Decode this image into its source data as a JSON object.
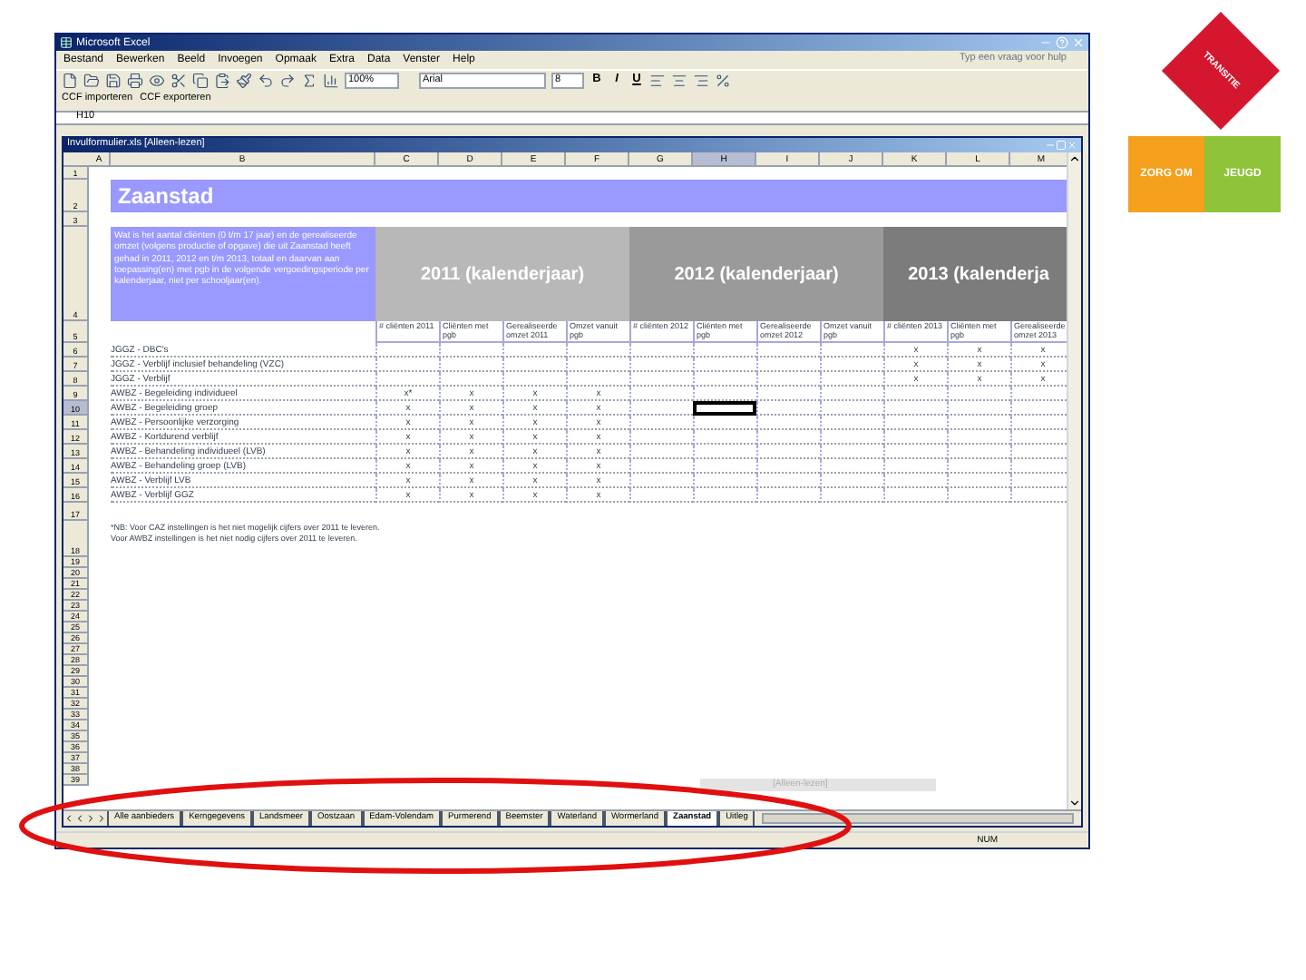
{
  "excel": {
    "title": "Microsoft Excel",
    "menu": [
      "Bestand",
      "Bewerken",
      "Beeld",
      "Invoegen",
      "Opmaak",
      "Extra",
      "Data",
      "Venster",
      "Help"
    ],
    "help_placeholder": "Typ een vraag voor hulp",
    "zoom": "100%",
    "font": "Arial",
    "font_size": "8",
    "format_buttons": [
      "B",
      "I",
      "U"
    ],
    "custom_toolbar": [
      "CCF importeren",
      "CCF exporteren"
    ],
    "name_box": "H10"
  },
  "workbook": {
    "title": "Invulformulier.xls  [Alleen-lezen]",
    "columns": [
      {
        "label": "A",
        "selected": false
      },
      {
        "label": "B",
        "selected": false
      },
      {
        "label": "C",
        "selected": false
      },
      {
        "label": "D",
        "selected": false
      },
      {
        "label": "E",
        "selected": false
      },
      {
        "label": "F",
        "selected": false
      },
      {
        "label": "G",
        "selected": false
      },
      {
        "label": "H",
        "selected": true
      },
      {
        "label": "I",
        "selected": false
      },
      {
        "label": "J",
        "selected": false
      },
      {
        "label": "K",
        "selected": false
      },
      {
        "label": "L",
        "selected": false
      },
      {
        "label": "M",
        "selected": false
      }
    ],
    "row_numbers": [
      {
        "label": "1",
        "selected": false
      },
      {
        "label": "2",
        "selected": false
      },
      {
        "label": "3",
        "selected": false
      },
      {
        "label": "4",
        "selected": false
      },
      {
        "label": "5",
        "selected": false
      },
      {
        "label": "6",
        "selected": false
      },
      {
        "label": "7",
        "selected": false
      },
      {
        "label": "8",
        "selected": false
      },
      {
        "label": "9",
        "selected": false
      },
      {
        "label": "10",
        "selected": true
      },
      {
        "label": "11",
        "selected": false
      },
      {
        "label": "12",
        "selected": false
      },
      {
        "label": "13",
        "selected": false
      },
      {
        "label": "14",
        "selected": false
      },
      {
        "label": "15",
        "selected": false
      },
      {
        "label": "16",
        "selected": false
      },
      {
        "label": "17",
        "selected": false
      },
      {
        "label": "18",
        "selected": false
      },
      {
        "label": "19",
        "selected": false
      },
      {
        "label": "20",
        "selected": false
      },
      {
        "label": "21",
        "selected": false
      },
      {
        "label": "22",
        "selected": false
      },
      {
        "label": "23",
        "selected": false
      },
      {
        "label": "24",
        "selected": false
      },
      {
        "label": "25",
        "selected": false
      },
      {
        "label": "26",
        "selected": false
      },
      {
        "label": "27",
        "selected": false
      },
      {
        "label": "28",
        "selected": false
      },
      {
        "label": "29",
        "selected": false
      },
      {
        "label": "30",
        "selected": false
      },
      {
        "label": "31",
        "selected": false
      },
      {
        "label": "32",
        "selected": false
      },
      {
        "label": "33",
        "selected": false
      },
      {
        "label": "34",
        "selected": false
      },
      {
        "label": "35",
        "selected": false
      },
      {
        "label": "36",
        "selected": false
      },
      {
        "label": "37",
        "selected": false
      },
      {
        "label": "38",
        "selected": false
      },
      {
        "label": "39",
        "selected": false
      }
    ],
    "sheet": {
      "title": "Zaanstad",
      "question": "Wat is het aantal cliënten (0 t/m 17 jaar) en de gerealiseerde omzet (volgens productie of opgave) die uit Zaanstad heeft gehad in 2011, 2012 en t/m 2013, totaal en daarvan aan toepassing(en) met pgb in de volgende vergoedingsperiode per kalenderjaar, niet per schooljaar(en).",
      "year_headers": [
        "2011 (kalenderjaar)",
        "2012 (kalenderjaar)",
        "2013 (kalenderja"
      ],
      "subheaders": [
        "# cliënten 2011",
        "Cliënten met pgb",
        "Gerealiseerde omzet 2011",
        "Omzet vanuit pgb",
        "# cliënten 2012",
        "Cliënten met pgb",
        "Gerealiseerde omzet 2012",
        "Omzet vanuit pgb",
        "# cliënten 2013",
        "Cliënten met pgb",
        "Gerealiseerde omzet 2013"
      ],
      "data_rows": [
        {
          "label": "JGGZ - DBC's",
          "cells": [
            "",
            "",
            "",
            "",
            "",
            "",
            "",
            "",
            "x",
            "x",
            "x"
          ]
        },
        {
          "label": "JGGZ - Verblijf inclusief behandeling (VZC)",
          "cells": [
            "",
            "",
            "",
            "",
            "",
            "",
            "",
            "",
            "x",
            "x",
            "x"
          ]
        },
        {
          "label": "JGGZ - Verblijf",
          "cells": [
            "",
            "",
            "",
            "",
            "",
            "",
            "",
            "",
            "x",
            "x",
            "x"
          ]
        },
        {
          "label": "AWBZ - Begeleiding individueel",
          "cells": [
            "x*",
            "x",
            "x",
            "x",
            "",
            "",
            "",
            "",
            "",
            "",
            ""
          ]
        },
        {
          "label": "AWBZ - Begeleiding groep",
          "cells": [
            "x",
            "x",
            "x",
            "x",
            "",
            "",
            "",
            "",
            "",
            "",
            ""
          ]
        },
        {
          "label": "AWBZ - Persoonlijke verzorging",
          "cells": [
            "x",
            "x",
            "x",
            "x",
            "",
            "",
            "",
            "",
            "",
            "",
            ""
          ]
        },
        {
          "label": "AWBZ - Kortdurend verblijf",
          "cells": [
            "x",
            "x",
            "x",
            "x",
            "",
            "",
            "",
            "",
            "",
            "",
            ""
          ]
        },
        {
          "label": "AWBZ - Behandeling individueel (LVB)",
          "cells": [
            "x",
            "x",
            "x",
            "x",
            "",
            "",
            "",
            "",
            "",
            "",
            ""
          ]
        },
        {
          "label": "AWBZ - Behandeling groep (LVB)",
          "cells": [
            "x",
            "x",
            "x",
            "x",
            "",
            "",
            "",
            "",
            "",
            "",
            ""
          ]
        },
        {
          "label": "AWBZ - Verblijf LVB",
          "cells": [
            "x",
            "x",
            "x",
            "x",
            "",
            "",
            "",
            "",
            "",
            "",
            ""
          ]
        },
        {
          "label": "AWBZ - Verblijf GGZ",
          "cells": [
            "x",
            "x",
            "x",
            "x",
            "",
            "",
            "",
            "",
            "",
            "",
            ""
          ]
        }
      ],
      "note": "*NB: Voor CAZ instellingen is het niet mogelijk cijfers over 2011 te leveren. Voor AWBZ instellingen is het niet nodig cijfers over 2011 te leveren."
    },
    "floating_label": "[Alleen-lezen]",
    "tabs": [
      {
        "label": "Alle aanbieders",
        "selected": false
      },
      {
        "label": "Kerngegevens",
        "selected": false
      },
      {
        "label": "Landsmeer",
        "selected": false
      },
      {
        "label": "Oostzaan",
        "selected": false
      },
      {
        "label": "Edam-Volendam",
        "selected": false
      },
      {
        "label": "Purmerend",
        "selected": false
      },
      {
        "label": "Beemster",
        "selected": false
      },
      {
        "label": "Waterland",
        "selected": false
      },
      {
        "label": "Wormerland",
        "selected": false
      },
      {
        "label": "Zaanstad",
        "selected": true
      },
      {
        "label": "Uitleg",
        "selected": false
      }
    ]
  },
  "status_bar": {
    "indicator": "NUM"
  },
  "logo": {
    "top": "TRANSITIE",
    "left": "ZORG OM",
    "right": "JEUGD"
  }
}
